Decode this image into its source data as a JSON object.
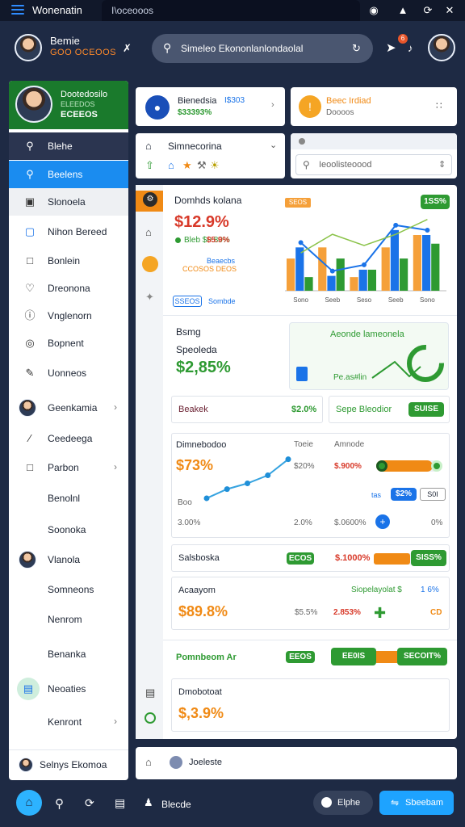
{
  "topbar": {
    "app_name": "Wonenatin",
    "tab_text": "I\\oceooos"
  },
  "header": {
    "user_name": "Bemie",
    "user_handle": "GOO OCEOOS",
    "search_text": "Simeleo Ekononlanlondaolal",
    "notif_count": "6"
  },
  "sidebar": {
    "profile_name": "Dootedosilo",
    "profile_sub": "ELEEDOS",
    "profile_value": "ECEEOS",
    "items": [
      {
        "label": "Blehe",
        "icon": "search-icon",
        "chevron": false
      },
      {
        "label": "Beelens",
        "icon": "search-icon",
        "chevron": false
      },
      {
        "label": "Slonoela",
        "icon": "image-icon",
        "chevron": false
      },
      {
        "label": "Nihon Bereed",
        "icon": "doc-icon",
        "chevron": false
      },
      {
        "label": "Bonlein",
        "icon": "square-icon",
        "chevron": false
      },
      {
        "label": "Dreonona",
        "icon": "tag-icon",
        "chevron": false
      },
      {
        "label": "Vnglenorn",
        "icon": "info-icon",
        "chevron": false
      },
      {
        "label": "Bopnent",
        "icon": "target-icon",
        "chevron": false
      },
      {
        "label": "Uonneos",
        "icon": "edit-icon",
        "chevron": false
      },
      {
        "label": "Geenkamia",
        "icon": "avatar-icon",
        "chevron": true
      },
      {
        "label": "Ceedeega",
        "icon": "pen-icon",
        "chevron": false
      },
      {
        "label": "Parbon",
        "icon": "square-icon",
        "chevron": true
      },
      {
        "label": "Benolnl",
        "icon": "",
        "chevron": false
      },
      {
        "label": "Soonoka",
        "icon": "",
        "chevron": false
      },
      {
        "label": "Vlanola",
        "icon": "avatar-icon",
        "chevron": false
      },
      {
        "label": "Somneons",
        "icon": "",
        "chevron": false
      },
      {
        "label": "Nenrom",
        "icon": "",
        "chevron": false
      },
      {
        "label": "Benanka",
        "icon": "",
        "chevron": false
      },
      {
        "label": "Neoaties",
        "icon": "chat-icon",
        "chevron": false
      },
      {
        "label": "Kenront",
        "icon": "",
        "chevron": true
      }
    ],
    "footer_label": "Selnys Ekomoa"
  },
  "cards": {
    "account": {
      "title": "Bienedsia",
      "value": "I$303",
      "sub": "$33393%"
    },
    "alert": {
      "title": "Beec Irdiad",
      "sub": "Doooos"
    },
    "filter": {
      "title": "Simnecorina"
    },
    "search2": {
      "placeholder": "Ieoolisteoood"
    }
  },
  "overview": {
    "title": "Domhds kolana",
    "value": "$12.9%",
    "line1": "Bleb $0.80%",
    "line2": "$5.9%",
    "line3": "Beaecbs",
    "line4": "CCOSOS DEOS",
    "chip": "SSEOS",
    "chip_label": "Sombde",
    "legend1": "SEOS",
    "badge": "1SS%"
  },
  "chart_data": {
    "type": "bar",
    "categories": [
      "Sono",
      "Seeb",
      "Seso",
      "Seeb",
      "Sono"
    ],
    "series": [
      {
        "name": "",
        "values": [
          2.6,
          3.5,
          1.1,
          3.5,
          4.5
        ],
        "color": "#f5a03a"
      },
      {
        "name": "",
        "values": [
          3.5,
          1.2,
          1.7,
          4.9,
          4.5
        ],
        "color": "#1a73e8"
      },
      {
        "name": "",
        "values": [
          1.1,
          2.6,
          1.7,
          2.6,
          3.8
        ],
        "color": "#2e9a32"
      }
    ],
    "xlabel": "",
    "ylabel": "",
    "ylim": [
      0,
      6
    ]
  },
  "saving": {
    "l1": "Bsmg",
    "l2": "Speoleda",
    "value": "$2,85%",
    "card_title": "Aeonde lameonela",
    "card_sub": "Pe.as#lin"
  },
  "row1": {
    "left": "Beakek",
    "left_val": "$2.0%",
    "right": "Sepe Bleodior",
    "right_pill": "SUISE"
  },
  "trend": {
    "title": "Dimnebodoo",
    "value": "$73%",
    "col2_head": "Toeie",
    "col2_val": "$20%",
    "col3_head": "Amnode",
    "col3_val": "$.900%",
    "low": "Boo",
    "low_val": "3.00%",
    "mid_val": "2.0%",
    "right_val": "$.0600%",
    "pct": "0%",
    "tag1": "tas",
    "tag1_pill": "$2%",
    "tag2_pill": "S0I",
    "slider_level": 0.85
  },
  "trend_chart": {
    "points": [
      [
        0,
        1.2
      ],
      [
        1,
        2.0
      ],
      [
        2,
        2.5
      ],
      [
        3,
        3.2
      ],
      [
        4,
        4.6
      ]
    ]
  },
  "row2": {
    "label": "Salsboska",
    "pill1": "ECOS",
    "value": "$.1000%",
    "pill2": "SISS%",
    "bar_level": 0.5
  },
  "row3": {
    "title": "Acaayom",
    "value": "$89.8%",
    "col2": "$5.5%",
    "col3": "2.853%",
    "right_head": "Siopelayolat $",
    "right_pct": "1 6%",
    "right_val": "CD"
  },
  "row4": {
    "label": "Pomnbeom Ar",
    "pill1": "EEOS",
    "pill2": "EE0IS",
    "pill3": "SECOIT%"
  },
  "row5": {
    "title": "Dmobotoat",
    "value": "$,3.9%"
  },
  "footer_card": {
    "label": "Joeleste"
  },
  "bottombar": {
    "label": "Blecde",
    "btn1": "Elphe",
    "btn2": "Sbeebam"
  },
  "colors": {
    "accent": "#1a73e8",
    "green": "#2e9a32",
    "orange": "#f08a15",
    "dark": "#1e2a44"
  }
}
